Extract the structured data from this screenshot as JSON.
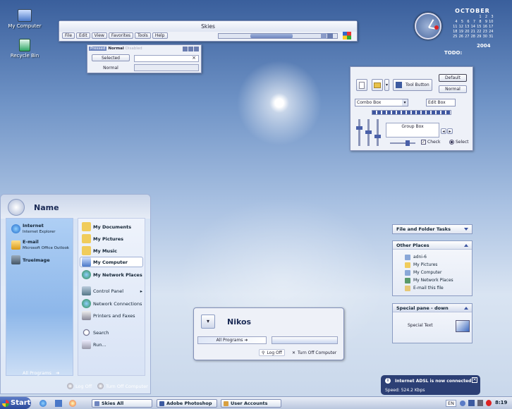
{
  "desktop": {
    "icons": [
      {
        "label": "My Computer"
      },
      {
        "label": "Recycle Bin"
      }
    ]
  },
  "calendar": {
    "month": "OCTOBER",
    "year": "2004",
    "today_label": "TODO:",
    "weeks": [
      [
        "",
        "",
        "",
        "",
        "1",
        "2",
        "3"
      ],
      [
        "4",
        "5",
        "6",
        "7",
        "8",
        "9",
        "10"
      ],
      [
        "11",
        "12",
        "13",
        "14",
        "15",
        "16",
        "17"
      ],
      [
        "18",
        "19",
        "20",
        "21",
        "22",
        "23",
        "24"
      ],
      [
        "25",
        "26",
        "27",
        "28",
        "29",
        "30",
        "31"
      ]
    ]
  },
  "skies_window": {
    "title": "Skies",
    "menu": [
      "File",
      "Edit",
      "View",
      "Favorites",
      "Tools",
      "Help"
    ]
  },
  "tabs_window": {
    "tabs": [
      "Pressed",
      "Normal",
      "Disabled"
    ],
    "buttons": [
      "Selected",
      "Normal"
    ],
    "close": "×"
  },
  "toolbar_window": {
    "tool_button": "Tool Button",
    "default_label": "Default",
    "normal_label": "Normal",
    "combo": "Combo Box",
    "edit": "Edit Box",
    "group": "Group Box",
    "check": "Check",
    "select": "Select"
  },
  "start_menu": {
    "user": "Name",
    "pinned": [
      {
        "title": "Internet",
        "sub": "Internet Explorer"
      },
      {
        "title": "E-mail",
        "sub": "Microsoft Office Outlook"
      },
      {
        "title": "TrueImage",
        "sub": ""
      }
    ],
    "places": [
      "My Documents",
      "My Pictures",
      "My Music",
      "My Computer",
      "My Network Places"
    ],
    "system": [
      "Control Panel",
      "Network Connections",
      "Printers and Faxes",
      "Search",
      "Run..."
    ],
    "all_programs": "All Programs",
    "log_off": "Log Off",
    "turn_off": "Turn Off Computer"
  },
  "mini_start": {
    "user": "Nikos",
    "all_programs": "All Programs",
    "log_off": "Log Off",
    "turn_off": "Turn Off Computer"
  },
  "task_pane": {
    "file_tasks": "File and Folder Tasks",
    "other_places": "Other Places",
    "places": [
      "adni-6",
      "My Pictures",
      "My Computer",
      "My Network Places",
      "E-mail this file"
    ],
    "special": "Special pane - down",
    "special_text": "Special Text"
  },
  "balloon": {
    "title": "Internet ADSL is now connected",
    "text": "Speed: 524.2 Kbps"
  },
  "taskbar": {
    "start": "Start",
    "tasks": [
      "Skies All",
      "Adobe Photoshop",
      "User Accounts"
    ],
    "lang": "EN",
    "clock": "8:19"
  }
}
